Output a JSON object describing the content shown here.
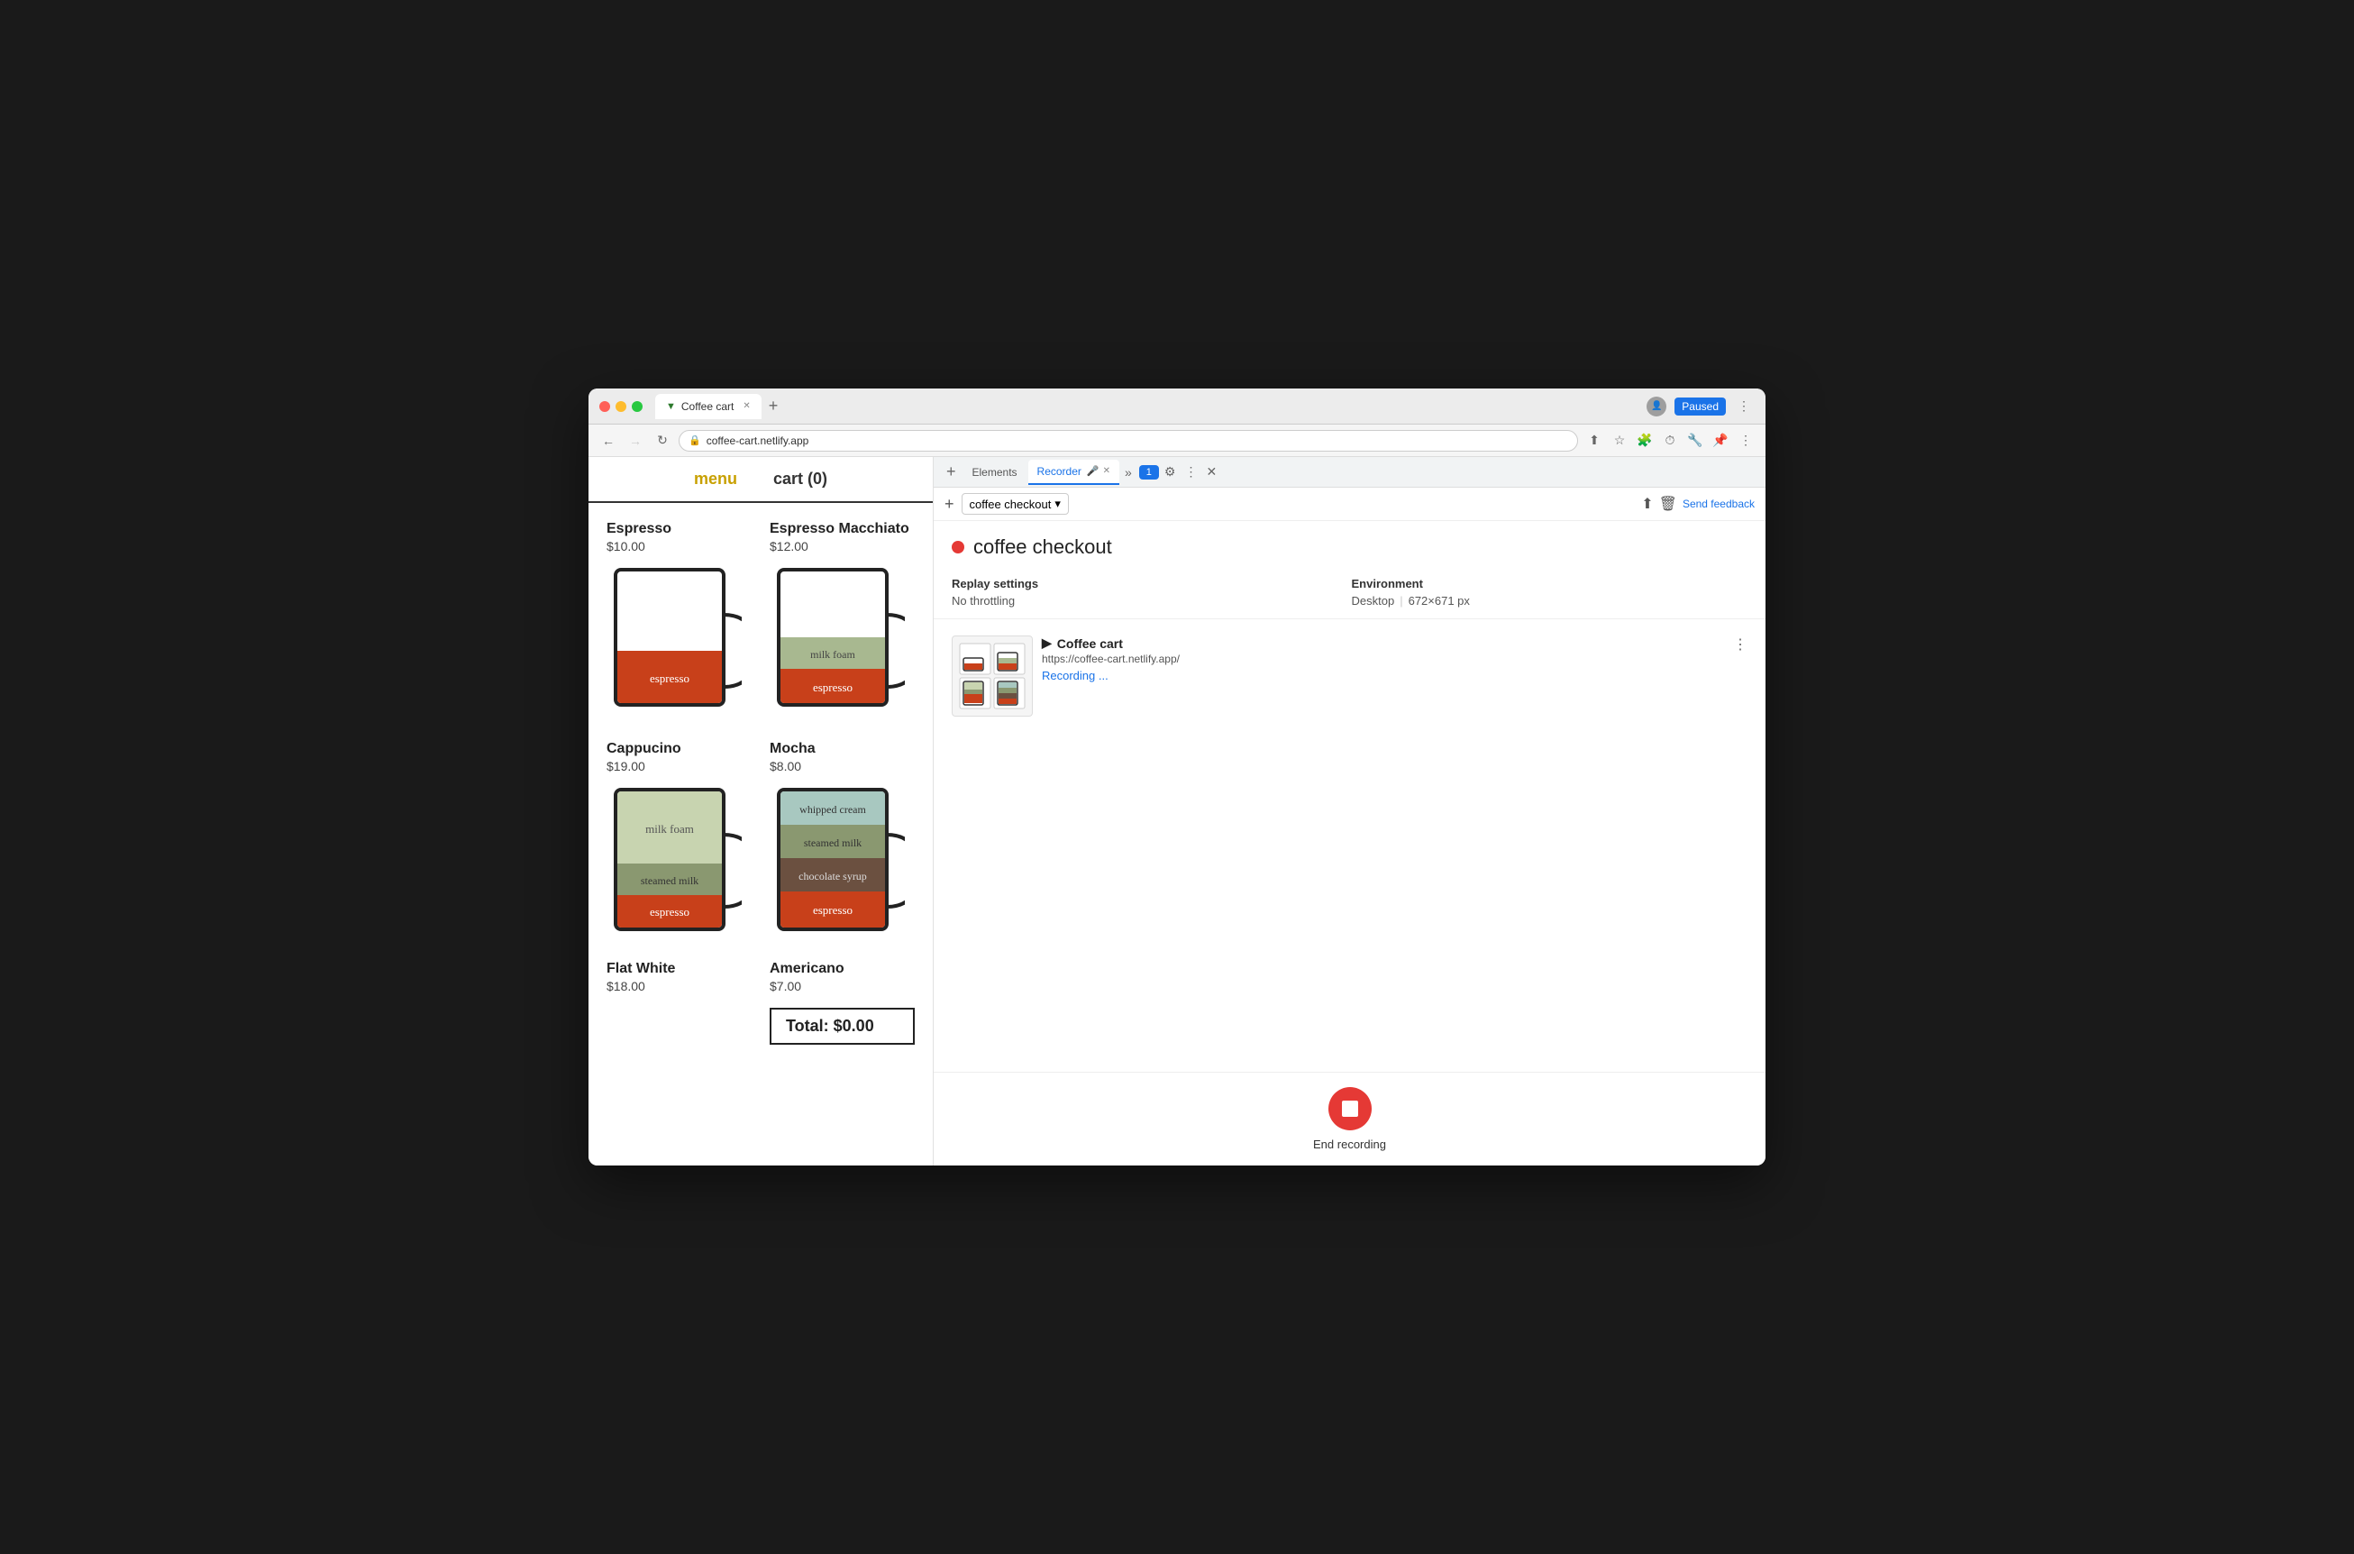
{
  "browser": {
    "url": "coffee-cart.netlify.app",
    "tab_title": "Coffee cart",
    "tab_favicon": "▼",
    "new_tab_symbol": "+",
    "back_disabled": false,
    "forward_disabled": true,
    "paused_label": "Paused"
  },
  "coffee_app": {
    "nav_menu": "menu",
    "nav_cart": "cart (0)",
    "items": [
      {
        "name": "Espresso",
        "price": "$10.00",
        "layers": [
          {
            "label": "espresso",
            "color": "#c8401a",
            "flex": 2
          }
        ]
      },
      {
        "name": "Espresso Macchiato",
        "price": "$12.00",
        "layers": [
          {
            "label": "milk foam",
            "color": "#a8b890",
            "flex": 1
          },
          {
            "label": "espresso",
            "color": "#c8401a",
            "flex": 2
          }
        ]
      },
      {
        "name": "Cappucino",
        "price": "$19.00",
        "layers": [
          {
            "label": "milk foam",
            "color": "#c8d4b0",
            "flex": 2
          },
          {
            "label": "steamed milk",
            "color": "#8a9870",
            "flex": 1
          },
          {
            "label": "espresso",
            "color": "#c8401a",
            "flex": 1
          }
        ]
      },
      {
        "name": "Mocha",
        "price": "$8.00",
        "layers": [
          {
            "label": "whipped cream",
            "color": "#a8c8c0",
            "flex": 1
          },
          {
            "label": "steamed milk",
            "color": "#8a9870",
            "flex": 1
          },
          {
            "label": "chocolate syrup",
            "color": "#6b5040",
            "flex": 1
          },
          {
            "label": "espresso",
            "color": "#c8401a",
            "flex": 1
          }
        ]
      }
    ],
    "bottom_items": [
      {
        "name": "Flat White",
        "price": "$18.00"
      },
      {
        "name": "Americano",
        "price": "$7.00"
      }
    ],
    "total": "Total: $0.00"
  },
  "devtools": {
    "tabs": [
      {
        "label": "Elements",
        "active": false
      },
      {
        "label": "Recorder",
        "active": true
      },
      {
        "label": "⚙",
        "active": false
      }
    ],
    "chat_btn": "1",
    "toolbar": {
      "add_btn": "+",
      "dropdown_label": "coffee checkout",
      "send_feedback": "Send feedback"
    },
    "recording": {
      "dot_color": "#e53935",
      "title": "coffee checkout",
      "replay_settings_label": "Replay settings",
      "no_throttling": "No throttling",
      "environment_label": "Environment",
      "env_value": "Desktop",
      "env_size": "672×671 px"
    },
    "step": {
      "title": "Coffee cart",
      "url": "https://coffee-cart.netlify.app/",
      "recording_status": "Recording ..."
    },
    "end_recording_label": "End recording"
  }
}
